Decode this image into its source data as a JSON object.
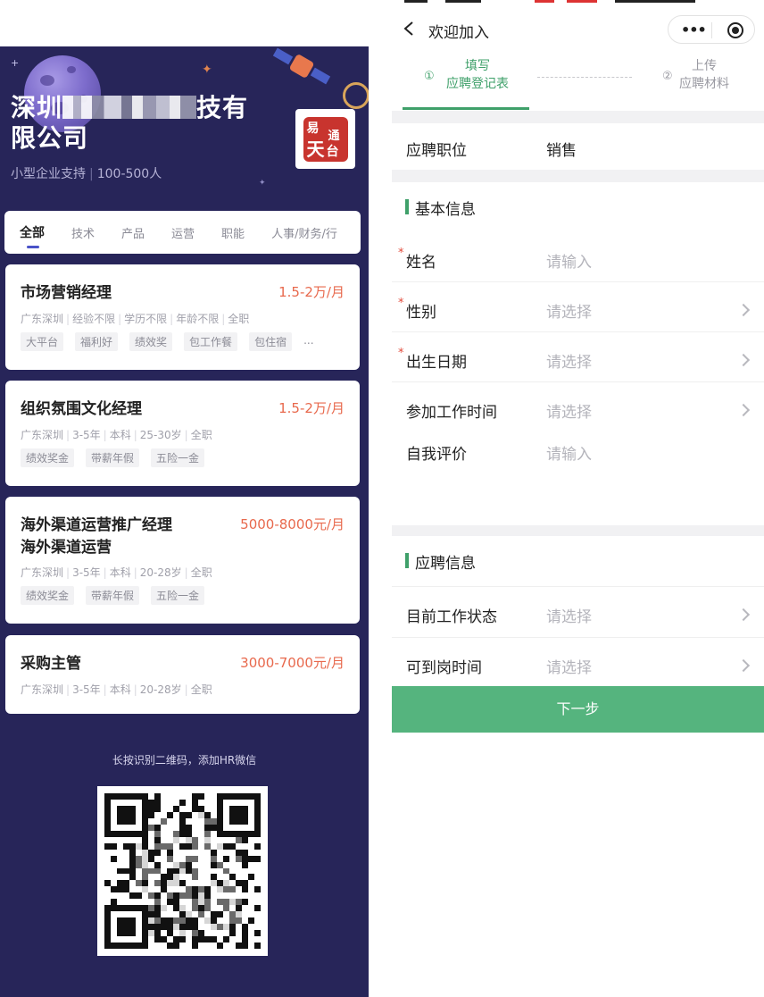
{
  "left": {
    "company": {
      "name_prefix": "深圳",
      "name_suffix": "技有",
      "name_line2": "限公司",
      "type": "小型企业支持",
      "size": "100-500人"
    },
    "tabs": [
      "全部",
      "技术",
      "产品",
      "运营",
      "职能",
      "人事/财务/行"
    ],
    "active_tab": 0,
    "jobs": [
      {
        "title": "市场营销经理",
        "salary": "1.5-2万/月",
        "meta": [
          "广东深圳",
          "经验不限",
          "学历不限",
          "年龄不限",
          "全职"
        ],
        "tags": [
          "大平台",
          "福利好",
          "绩效奖",
          "包工作餐",
          "包住宿"
        ],
        "more": "..."
      },
      {
        "title": "组织氛围文化经理",
        "salary": "1.5-2万/月",
        "meta": [
          "广东深圳",
          "3-5年",
          "本科",
          "25-30岁",
          "全职"
        ],
        "tags": [
          "绩效奖金",
          "带薪年假",
          "五险一金"
        ]
      },
      {
        "title_line1": "海外渠道运营推广经理",
        "title_line2": "海外渠道运营",
        "salary": "5000-8000元/月",
        "meta": [
          "广东深圳",
          "3-5年",
          "本科",
          "20-28岁",
          "全职"
        ],
        "tags": [
          "绩效奖金",
          "带薪年假",
          "五险一金"
        ]
      },
      {
        "title": "采购主管",
        "salary": "3000-7000元/月",
        "meta": [
          "广东深圳",
          "3-5年",
          "本科",
          "20-28岁",
          "全职"
        ]
      }
    ],
    "qr_caption": "长按识别二维码，添加HR微信"
  },
  "right": {
    "nav": {
      "title": "欢迎加入",
      "back_icon": "chevron-left-icon",
      "more_icon": "more-dots-icon",
      "close_icon": "target-circle-icon"
    },
    "steps": [
      {
        "num": "①",
        "line1": "填写",
        "line2": "应聘登记表",
        "active": true
      },
      {
        "num": "②",
        "line1": "上传",
        "line2": "应聘材料",
        "active": false
      }
    ],
    "position": {
      "label": "应聘职位",
      "value": "销售"
    },
    "basic_section": "基本信息",
    "basic_fields": [
      {
        "label": "姓名",
        "required": true,
        "placeholder": "请输入",
        "type": "input"
      },
      {
        "label": "性别",
        "required": true,
        "placeholder": "请选择",
        "type": "select"
      },
      {
        "label": "出生日期",
        "required": true,
        "placeholder": "请选择",
        "type": "select"
      },
      {
        "label": "参加工作时间",
        "required": false,
        "placeholder": "请选择",
        "type": "select"
      },
      {
        "label": "自我评价",
        "required": false,
        "placeholder": "请输入",
        "type": "textarea"
      }
    ],
    "apply_section": "应聘信息",
    "apply_fields": [
      {
        "label": "目前工作状态",
        "placeholder": "请选择",
        "type": "select"
      },
      {
        "label": "可到岗时间",
        "placeholder": "请选择",
        "type": "select"
      }
    ],
    "next_button": "下一步",
    "required_mark": "*"
  },
  "colors": {
    "left_bg": "#272559",
    "salary": "#e8694d",
    "accent_green": "#3fa06a",
    "button_green": "#55b47e",
    "required_red": "#e24a3b"
  }
}
